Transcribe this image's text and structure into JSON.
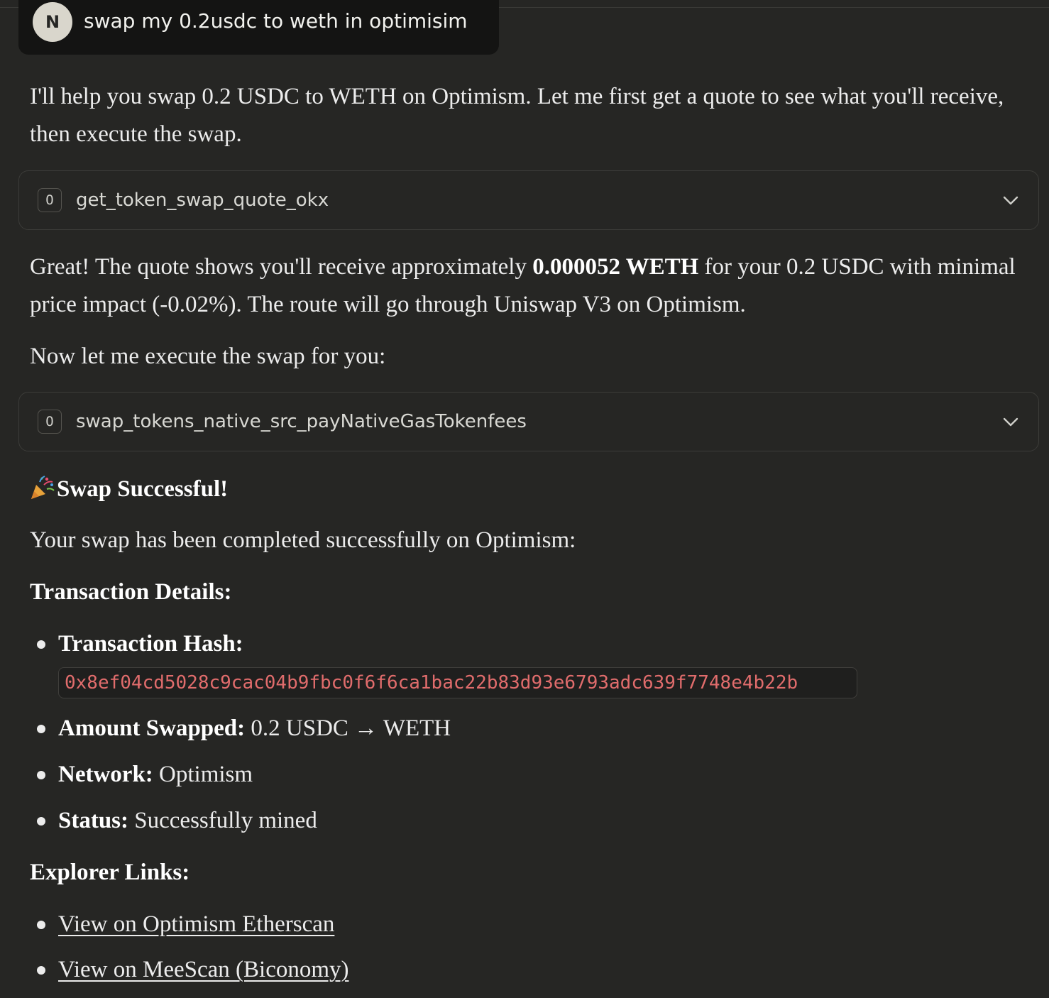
{
  "user_message": {
    "avatar_initial": "N",
    "text": "swap my 0.2usdc to weth in optimisim"
  },
  "assistant": {
    "intro": "I'll help you swap 0.2 USDC to WETH on Optimism. Let me first get a quote to see what you'll receive, then execute the swap.",
    "tool_calls": [
      {
        "badge": "O",
        "name": "get_token_swap_quote_okx"
      },
      {
        "badge": "O",
        "name": "swap_tokens_native_src_payNativeGasTokenfees"
      }
    ],
    "quote_summary": {
      "prefix": "Great! The quote shows you'll receive approximately ",
      "amount": "0.000052 WETH",
      "suffix": " for your 0.2 USDC with minimal price impact (-0.02%). The route will go through Uniswap V3 on Optimism."
    },
    "execute_text": "Now let me execute the swap for you:",
    "success_heading": "Swap Successful!",
    "completed_text": "Your swap has been completed successfully on Optimism:",
    "details_heading": "Transaction Details:",
    "details": {
      "hash_label": "Transaction Hash:",
      "hash_value": "0x8ef04cd5028c9cac04b9fbc0f6f6ca1bac22b83d93e6793adc639f7748e4b22b",
      "amount_label": "Amount Swapped:",
      "amount_value": " 0.2 USDC → WETH",
      "network_label": "Network:",
      "network_value": " Optimism",
      "status_label": "Status:",
      "status_value": " Successfully mined"
    },
    "explorer_heading": "Explorer Links:",
    "explorer_links": [
      "View on Optimism Etherscan",
      "View on MeeScan (Biconomy)"
    ]
  },
  "colors": {
    "background": "#262624",
    "user_bubble": "#141413",
    "hash_text": "#e06c6c"
  }
}
